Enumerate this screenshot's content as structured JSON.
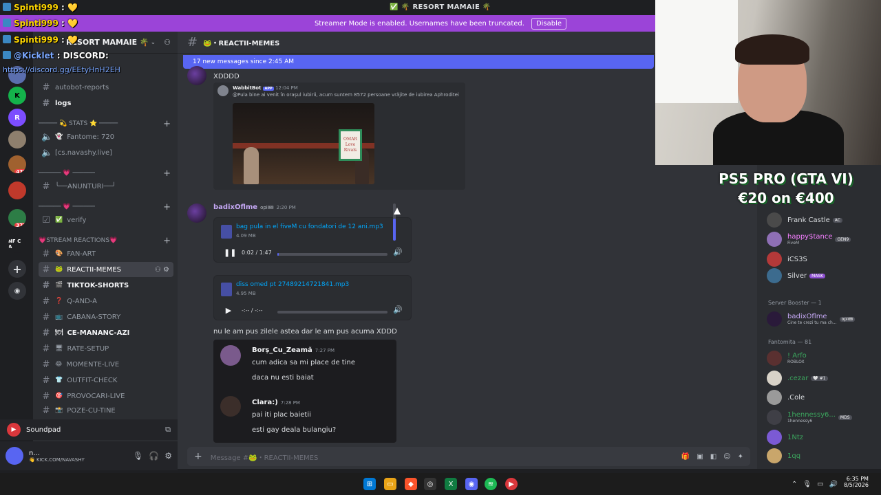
{
  "window": {
    "title": "✅ 🌴 RESORT MAMAIE 🌴"
  },
  "banner": {
    "message": "Streamer Mode is enabled. Usernames have been truncated.",
    "button": "Disable"
  },
  "server": {
    "name": "RESORT MAMAIE 🌴"
  },
  "servers": [
    {
      "label": "",
      "badge": ""
    },
    {
      "label": "K",
      "badge": ""
    },
    {
      "label": "R",
      "badge": ""
    },
    {
      "label": "",
      "badge": ""
    },
    {
      "label": "",
      "badge": "479"
    },
    {
      "label": "",
      "badge": ""
    },
    {
      "label": "",
      "badge": "377"
    },
    {
      "label": "NF C A",
      "badge": ""
    }
  ],
  "channels": [
    {
      "label": "autobot-reports",
      "icon": "hash",
      "emoji": "",
      "kind": "text"
    },
    {
      "label": "logs",
      "icon": "hash",
      "emoji": "",
      "kind": "text"
    },
    {
      "label": "───── 💫 STATS ⭐ ─────",
      "icon": "",
      "emoji": "",
      "kind": "category"
    },
    {
      "label": "Fantome: 720",
      "icon": "speaker",
      "emoji": "👻",
      "kind": "voice"
    },
    {
      "label": "[cs.navashy.live]",
      "icon": "speaker",
      "emoji": "",
      "kind": "voice"
    },
    {
      "label": "────── 💗 ──────",
      "icon": "",
      "emoji": "",
      "kind": "category"
    },
    {
      "label": "╰──ANUNTURI──╯",
      "icon": "hash",
      "emoji": "",
      "kind": "text"
    },
    {
      "label": "────── 💗 ──────",
      "icon": "",
      "emoji": "",
      "kind": "category"
    },
    {
      "label": "verify",
      "icon": "check",
      "emoji": "✅",
      "kind": "text"
    },
    {
      "label": "💗STREAM REACTIONS💗",
      "icon": "",
      "emoji": "",
      "kind": "category"
    },
    {
      "label": "FAN-ART",
      "icon": "hash",
      "emoji": "🎨",
      "kind": "text"
    },
    {
      "label": "REACTII-MEMES",
      "icon": "hash",
      "emoji": "🐸",
      "kind": "text"
    },
    {
      "label": "TIKTOK-SHORTS",
      "icon": "hash",
      "emoji": "🎬",
      "kind": "text"
    },
    {
      "label": "Q-AND-A",
      "icon": "hash",
      "emoji": "❓",
      "kind": "text"
    },
    {
      "label": "CABANA-STORY",
      "icon": "hash",
      "emoji": "📺",
      "kind": "text"
    },
    {
      "label": "CE-MANANC-AZI",
      "icon": "hash",
      "emoji": "🍽",
      "kind": "text"
    },
    {
      "label": "RATE-SETUP",
      "icon": "hash",
      "emoji": "🖥",
      "kind": "text"
    },
    {
      "label": "MOMENTE-LIVE",
      "icon": "hash",
      "emoji": "😂",
      "kind": "text"
    },
    {
      "label": "OUTFIT-CHECK",
      "icon": "hash",
      "emoji": "👕",
      "kind": "text"
    },
    {
      "label": "PROVOCARI-LIVE",
      "icon": "hash",
      "emoji": "🎯",
      "kind": "text"
    },
    {
      "label": "POZE-CU-TINE",
      "icon": "hash",
      "emoji": "📸",
      "kind": "text"
    }
  ],
  "soundpad": {
    "label": "Soundpad"
  },
  "user": {
    "name": "n...",
    "status": "👋 KICK.COM/NAVASHY"
  },
  "chat": {
    "channel": "🐸・REACTII-MEMES",
    "new_messages": "17 new messages since 2:45 AM",
    "msg1_text": "XDDDD",
    "embed": {
      "bot": "WabbitBot",
      "bot_tag": "APP",
      "bot_time": "12:04 PM",
      "text": "@Pula bine ai venit în orașul iubirii, acum suntem 8572 persoane vrăjite de iubirea Aphroditei",
      "sign_1": "OMAR",
      "sign_2": "Love",
      "sign_3": "Rivals"
    },
    "msg2_author": "badixOflme",
    "msg2_tag": "opi🎟",
    "msg2_time": "2:20 PM",
    "audio1": {
      "name": "bag pula in el fiveM cu fondatori de 12 ani.mp3",
      "size": "4.09 MB",
      "time": "0:02 / 1:47",
      "progress": 0.01
    },
    "audio2": {
      "name": "diss omed pt 27489214721841.mp3",
      "size": "4.95 MB",
      "time": "-:-- / -:--",
      "progress": 0
    },
    "volume": 0.6,
    "msg3_text": "nu le am pus zilele astea dar le am pus acuma XDDD",
    "screenshot": {
      "u1": "Borș_Cu_Zeamă",
      "t1": "7:27 PM",
      "l1": "cum adica sa mi place de tine",
      "l2": "daca nu esti baiat",
      "u2": "Clara:)",
      "t2": "7:28 PM",
      "l3": "pai iti plac baietii",
      "l4": "esti gay deala bulangiu?"
    },
    "composer_placeholder": "Message #🐸・REACTII-MEMES"
  },
  "members": {
    "items": [
      {
        "name": "Frank Castle",
        "sub": "",
        "badge": "AC",
        "color": "#dbdee1"
      },
      {
        "name": "happy$tance",
        "sub": "FiveM",
        "badge": "GEN9",
        "color": "#f47fff"
      },
      {
        "name": "iCS3S",
        "sub": "",
        "badge": "",
        "color": "#dbdee1"
      },
      {
        "name": "Silver",
        "sub": "",
        "badge": "MASK",
        "color": "#dbdee1"
      }
    ],
    "booster_header": "Server Booster — 1",
    "booster": {
      "name": "badixOflme",
      "sub": "Cine te crezi tu ma ch...",
      "badge": "opi🎟",
      "color": "#c5a8f5"
    },
    "fantomita_header": "Fantomita — 81",
    "fantomita": [
      {
        "name": "! Arfo",
        "sub": "ROBLOX",
        "badge": "",
        "color": "#3ba55d"
      },
      {
        "name": ".cezar",
        "sub": "",
        "badge": "🤍 #1",
        "color": "#3ba55d"
      },
      {
        "name": ".Cole",
        "sub": "",
        "badge": "",
        "color": "#dbdee1"
      },
      {
        "name": "1hennessy6...",
        "sub": "1hennessy6",
        "badge": "MDS",
        "color": "#3ba55d"
      },
      {
        "name": "1Ntz",
        "sub": "",
        "badge": "",
        "color": "#3ba55d"
      },
      {
        "name": "1qq",
        "sub": "",
        "badge": "",
        "color": "#3ba55d"
      }
    ]
  },
  "overlay": {
    "chat": [
      {
        "user": "Spinti999",
        "text": ": 💛"
      },
      {
        "user": "Spinti999",
        "text": ": 💛"
      },
      {
        "user": "Spinti999",
        "text": ": 💛"
      }
    ],
    "kicklet_user": "@Kicklet",
    "kicklet_text": ": DISCORD:",
    "link": "https://discord.gg/EEtyHnH2EH",
    "promo_line1": "PS5 PRO (GTA VI)",
    "promo_line2": "€20 on €400"
  },
  "clock": {
    "time": "6:35 PM",
    "date": "8/5/2026"
  }
}
